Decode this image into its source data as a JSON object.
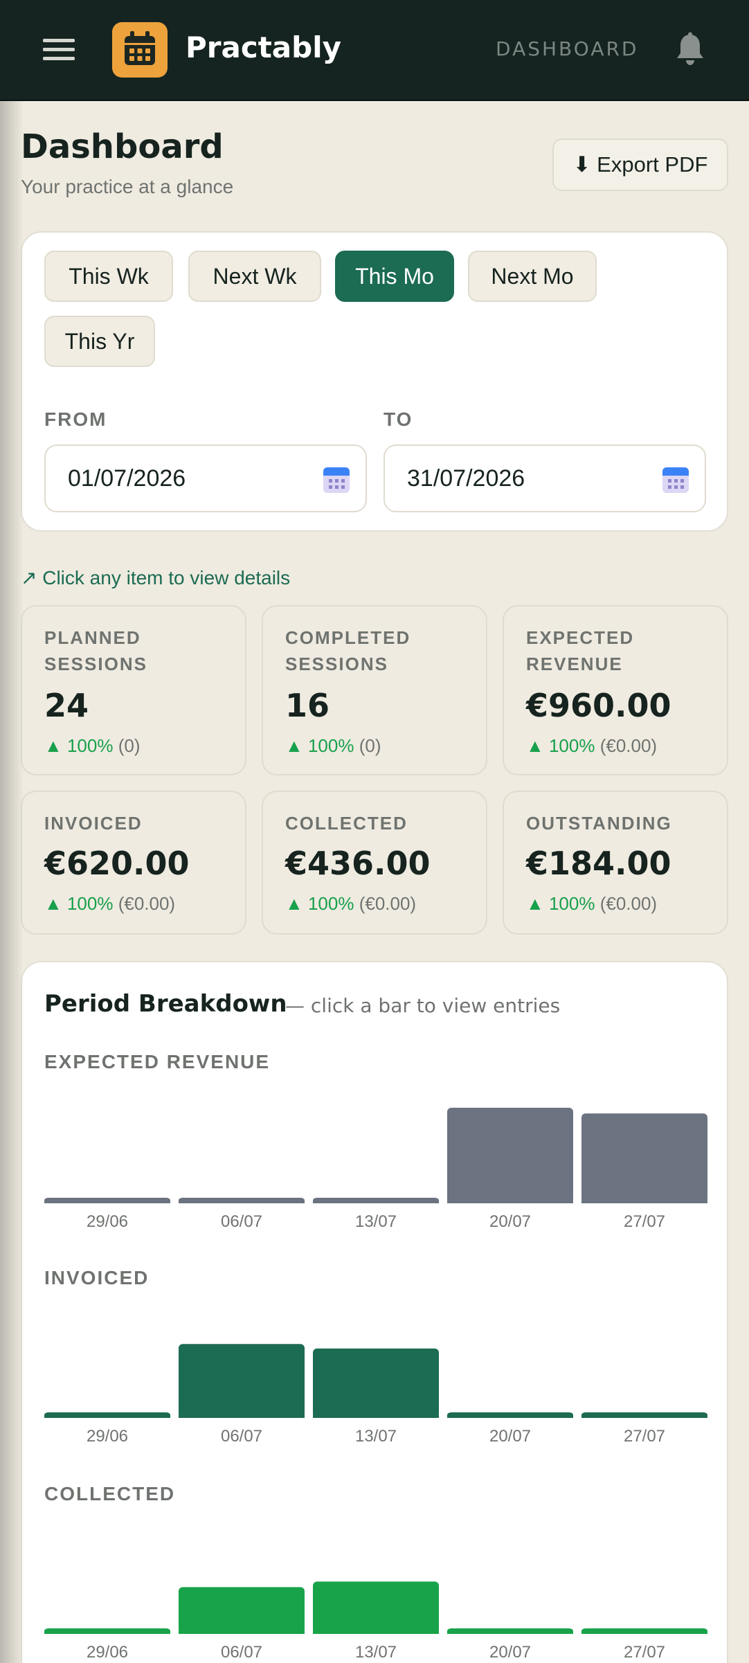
{
  "app": {
    "name": "Practably",
    "nav_link": "DASHBOARD"
  },
  "header": {
    "title": "Dashboard",
    "subtitle": "Your practice at a glance",
    "export_label": "⬇ Export PDF"
  },
  "filters": {
    "presets": [
      {
        "label": "This Wk",
        "active": false
      },
      {
        "label": "Next Wk",
        "active": false
      },
      {
        "label": "This Mo",
        "active": true
      },
      {
        "label": "Next Mo",
        "active": false
      },
      {
        "label": "This Yr",
        "active": false
      }
    ],
    "from_label": "FROM",
    "from_value": "01/07/2026",
    "to_label": "TO",
    "to_value": "31/07/2026"
  },
  "hint": "↗ Click any item to view details",
  "stats": [
    {
      "label": "PLANNED SESSIONS",
      "value": "24",
      "change": "▲ 100%",
      "prev": "(0)"
    },
    {
      "label": "COMPLETED SESSIONS",
      "value": "16",
      "change": "▲ 100%",
      "prev": "(0)"
    },
    {
      "label": "EXPECTED REVENUE",
      "value": "€960.00",
      "change": "▲ 100%",
      "prev": "(€0.00)"
    },
    {
      "label": "INVOICED",
      "value": "€620.00",
      "change": "▲ 100%",
      "prev": "(€0.00)"
    },
    {
      "label": "COLLECTED",
      "value": "€436.00",
      "change": "▲ 100%",
      "prev": "(€0.00)"
    },
    {
      "label": "OUTSTANDING",
      "value": "€184.00",
      "change": "▲ 100%",
      "prev": "(€0.00)"
    }
  ],
  "breakdown": {
    "title": "Period Breakdown",
    "subtitle": "— click a bar to view entries"
  },
  "colors": {
    "brand": "#1c6b53",
    "accent": "#eda23c",
    "expected_bar": "#6b7280",
    "invoiced_bar": "#1c6b53",
    "collected_bar": "#18a34a",
    "up": "#18a04b"
  },
  "icons": {
    "menu": "hamburger-icon",
    "logo": "calendar-icon",
    "notifications": "bell-icon",
    "date_picker": "calendar-icon"
  },
  "chart_data": [
    {
      "type": "bar",
      "title": "EXPECTED REVENUE",
      "categories": [
        "29/06",
        "06/07",
        "13/07",
        "20/07",
        "27/07"
      ],
      "values": [
        0,
        0,
        0,
        420,
        395
      ],
      "color": "#6b7280"
    },
    {
      "type": "bar",
      "title": "INVOICED",
      "categories": [
        "29/06",
        "06/07",
        "13/07",
        "20/07",
        "27/07"
      ],
      "values": [
        0,
        325,
        305,
        0,
        0
      ],
      "color": "#1c6b53"
    },
    {
      "type": "bar",
      "title": "COLLECTED",
      "categories": [
        "29/06",
        "06/07",
        "13/07",
        "20/07",
        "27/07"
      ],
      "values": [
        0,
        206,
        230,
        0,
        0
      ],
      "color": "#18a34a"
    }
  ]
}
